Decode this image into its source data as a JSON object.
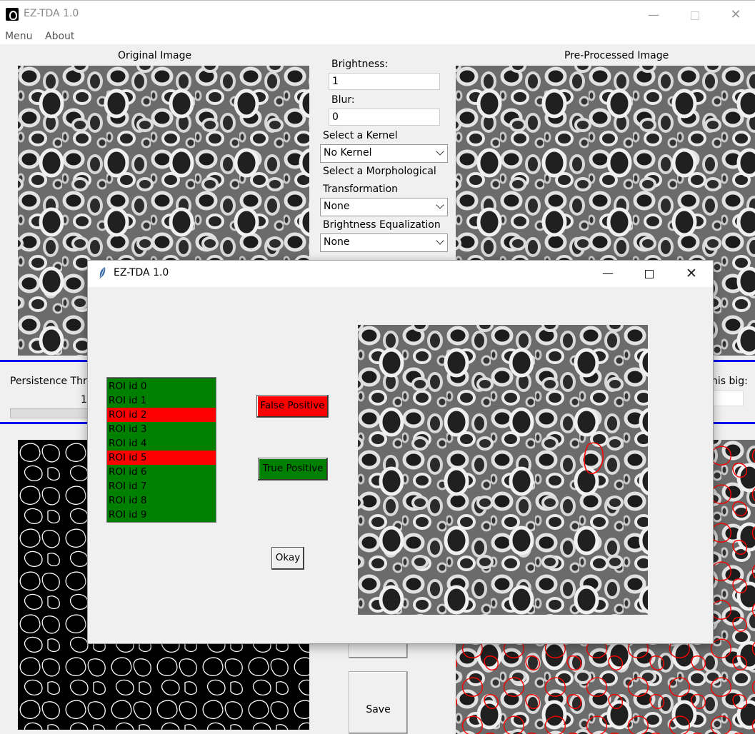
{
  "window": {
    "title": "EZ-TDA 1.0",
    "min_glyph": "—",
    "close_glyph": "✕"
  },
  "menu": [
    "Menu",
    "About"
  ],
  "panels": {
    "original_title": "Original Image",
    "preprocessed_title": "Pre-Processed Image"
  },
  "controls": {
    "brightness_label": "Brightness:",
    "brightness_value": "1",
    "blur_label": "Blur:",
    "blur_value": "0",
    "kernel_label": "Select a Kernel",
    "kernel_value": "No Kernel",
    "morph_label_1": "Select a Morphological",
    "morph_label_2": "Transformation",
    "morph_value": "None",
    "equalization_label": "Brightness Equalization",
    "equalization_value": "None"
  },
  "persistence": {
    "label": "Persistence Thres",
    "value": "1"
  },
  "size_filter": {
    "label": "his big:"
  },
  "buttons": {
    "save_masks": "Save Masks"
  },
  "dialog": {
    "title": "EZ-TDA 1.0",
    "min_glyph": "—",
    "close_glyph": "✕",
    "roi_items": [
      {
        "label": "ROI id 0",
        "status": "true_positive"
      },
      {
        "label": "ROI id 1",
        "status": "true_positive"
      },
      {
        "label": "ROI id 2",
        "status": "false_positive"
      },
      {
        "label": "ROI id 3",
        "status": "true_positive"
      },
      {
        "label": "ROI id 4",
        "status": "true_positive"
      },
      {
        "label": "ROI id 5",
        "status": "false_positive"
      },
      {
        "label": "ROI id 6",
        "status": "true_positive"
      },
      {
        "label": "ROI id 7",
        "status": "true_positive"
      },
      {
        "label": "ROI id 8",
        "status": "true_positive"
      },
      {
        "label": "ROI id 9",
        "status": "true_positive"
      }
    ],
    "false_positive_label": "False Positive",
    "true_positive_label": "True Positive",
    "okay_label": "Okay"
  },
  "colors": {
    "true_positive": "#008000",
    "false_positive": "#ff0000",
    "separator": "#0000ee",
    "roi_outline": "#ff0000",
    "mask_outline": "#ffffff"
  },
  "icons": {
    "app": "app-logo-icon",
    "dialog": "feather-icon"
  }
}
